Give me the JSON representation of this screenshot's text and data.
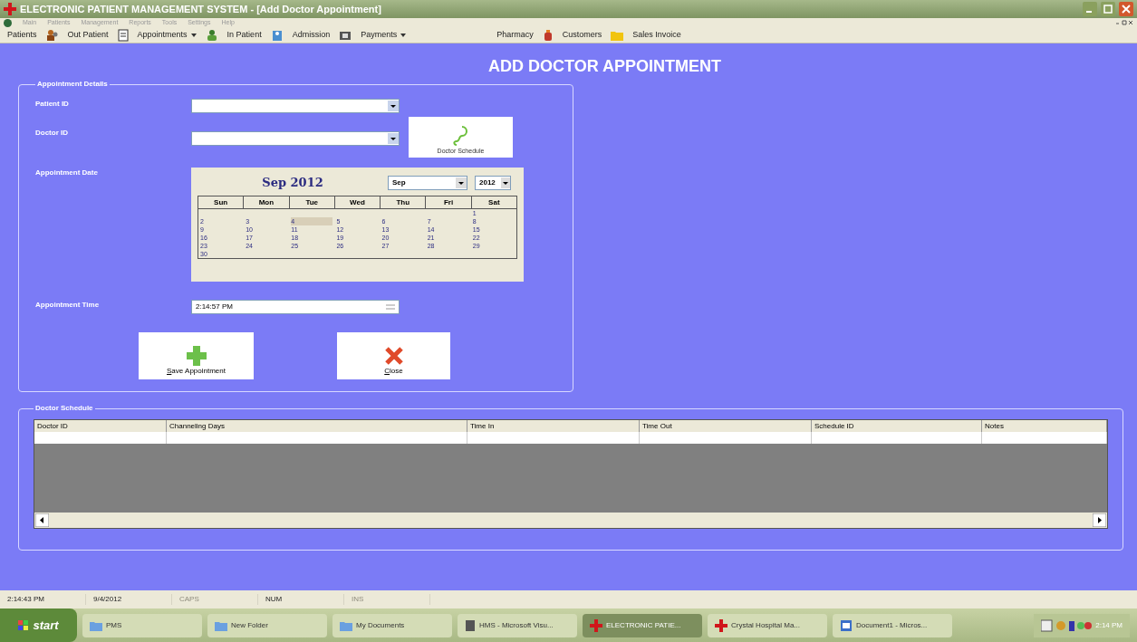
{
  "window": {
    "title": "ELECTRONIC PATIENT MANAGEMENT SYSTEM - [Add Doctor Appointment]"
  },
  "menu": [
    "Main",
    "Patients",
    "Management",
    "Reports",
    "Tools",
    "Settings",
    "Help"
  ],
  "toolbar": [
    {
      "label": "Patients",
      "has_menu": false,
      "kind": "people"
    },
    {
      "label": "Out Patient",
      "has_menu": false,
      "kind": "doc"
    },
    {
      "label": "Appointments",
      "has_menu": true,
      "kind": "person"
    },
    {
      "label": "In Patient",
      "has_menu": false,
      "kind": "bed"
    },
    {
      "label": "Admission",
      "has_menu": false,
      "kind": "box"
    },
    {
      "label": "Payments",
      "has_menu": true,
      "kind": "plain"
    },
    {
      "label": "Pharmacy",
      "has_menu": false,
      "kind": "bottle"
    },
    {
      "label": "Customers",
      "has_menu": false,
      "kind": "folder"
    },
    {
      "label": "Sales Invoice",
      "has_menu": false,
      "kind": "plain"
    }
  ],
  "heading": "ADD DOCTOR APPOINTMENT",
  "details": {
    "legend": "Appointment Details",
    "patient_id": {
      "label": "Patient ID"
    },
    "doctor_id": {
      "label": "Doctor ID"
    },
    "schedule_button": "Doctor Schedule",
    "date": {
      "label": "Appointment Date",
      "calendar": {
        "title": "Sep 2012",
        "month": "Sep",
        "year": "2012",
        "weekdays": [
          "Sun",
          "Mon",
          "Tue",
          "Wed",
          "Thu",
          "Fri",
          "Sat"
        ],
        "weeks": [
          {
            "kind": "first",
            "days": [
              {
                "text": "1",
                "selected": false
              }
            ]
          },
          {
            "kind": "full",
            "days": [
              {
                "text": "2",
                "selected": false
              },
              {
                "text": "3",
                "selected": false
              },
              {
                "text": "4",
                "selected": true
              },
              {
                "text": "5",
                "selected": false
              },
              {
                "text": "6",
                "selected": false
              },
              {
                "text": "7",
                "selected": false
              },
              {
                "text": "8",
                "selected": false
              }
            ]
          },
          {
            "kind": "full",
            "days": [
              {
                "text": "9",
                "selected": false
              },
              {
                "text": "10",
                "selected": false
              },
              {
                "text": "11",
                "selected": false
              },
              {
                "text": "12",
                "selected": false
              },
              {
                "text": "13",
                "selected": false
              },
              {
                "text": "14",
                "selected": false
              },
              {
                "text": "15",
                "selected": false
              }
            ]
          },
          {
            "kind": "full",
            "days": [
              {
                "text": "16",
                "selected": false
              },
              {
                "text": "17",
                "selected": false
              },
              {
                "text": "18",
                "selected": false
              },
              {
                "text": "19",
                "selected": false
              },
              {
                "text": "20",
                "selected": false
              },
              {
                "text": "21",
                "selected": false
              },
              {
                "text": "22",
                "selected": false
              }
            ]
          },
          {
            "kind": "full",
            "days": [
              {
                "text": "23",
                "selected": false
              },
              {
                "text": "24",
                "selected": false
              },
              {
                "text": "25",
                "selected": false
              },
              {
                "text": "26",
                "selected": false
              },
              {
                "text": "27",
                "selected": false
              },
              {
                "text": "28",
                "selected": false
              },
              {
                "text": "29",
                "selected": false
              }
            ]
          },
          {
            "kind": "last",
            "days": [
              {
                "text": "30",
                "selected": false
              }
            ]
          }
        ]
      }
    },
    "time": {
      "label": "Appointment Time",
      "value": "2:14:57 PM"
    },
    "save_button": {
      "accel": "S",
      "rest": "ave Appointment"
    },
    "close_button": {
      "accel": "C",
      "rest": "lose"
    }
  },
  "schedule": {
    "legend": "Doctor Schedule",
    "columns": [
      "Doctor ID",
      "Channeling Days",
      "Time In",
      "Time Out",
      "Schedule ID",
      "Notes"
    ]
  },
  "status_bar": [
    {
      "text": "2:14:43 PM",
      "disabled": false
    },
    {
      "text": "9/4/2012",
      "disabled": false
    },
    {
      "text": "CAPS",
      "disabled": true
    },
    {
      "text": "NUM",
      "disabled": false
    },
    {
      "text": "INS",
      "disabled": true
    }
  ],
  "taskbar": {
    "start": "start",
    "items": [
      {
        "label": "PMS",
        "selected": false,
        "kind": "folder"
      },
      {
        "label": "New Folder",
        "selected": false,
        "kind": "folder"
      },
      {
        "label": "My Documents",
        "selected": false,
        "kind": "folder"
      },
      {
        "label": "HMS - Microsoft Visu...",
        "selected": false,
        "kind": "app"
      },
      {
        "label": "ELECTRONIC PATIE...",
        "selected": true,
        "kind": "cross"
      },
      {
        "label": "Crystal Hospital Ma...",
        "selected": false,
        "kind": "cross"
      },
      {
        "label": "Document1 - Micros...",
        "selected": false,
        "kind": "word"
      }
    ],
    "clock": "2:14 PM"
  }
}
